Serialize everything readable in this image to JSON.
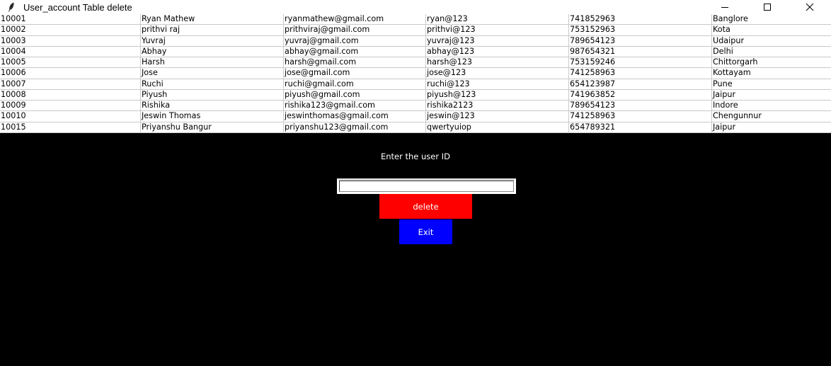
{
  "window": {
    "title": "User_account Table delete",
    "title_icon": "feather-icon",
    "controls": [
      "minimize-icon",
      "maximize-icon",
      "close-icon"
    ]
  },
  "table": {
    "rows": [
      [
        "10001",
        "Ryan Mathew",
        "ryanmathew@gmail.com",
        "ryan@123",
        "741852963",
        "Banglore"
      ],
      [
        "10002",
        "prithvi raj",
        "prithviraj@gmail.com",
        "prithvi@123",
        "753152963",
        "Kota"
      ],
      [
        "10003",
        "Yuvraj",
        "yuvraj@gmail.com",
        "yuvraj@123",
        "789654123",
        "Udaipur"
      ],
      [
        "10004",
        "Abhay",
        "abhay@gmail.com",
        "abhay@123",
        "987654321",
        "Delhi"
      ],
      [
        "10005",
        "Harsh",
        "harsh@gmail.com",
        "harsh@123",
        "753159246",
        "Chittorgarh"
      ],
      [
        "10006",
        "Jose",
        "jose@gmail.com",
        "jose@123",
        "741258963",
        "Kottayam"
      ],
      [
        "10007",
        "Ruchi",
        "ruchi@gmail.com",
        "ruchi@123",
        "654123987",
        "Pune"
      ],
      [
        "10008",
        "Piyush",
        "piyush@gmail.com",
        "piyush@123",
        "741963852",
        "Jaipur"
      ],
      [
        "10009",
        "Rishika",
        "rishika123@gmail.com",
        "rishika2123",
        "789654123",
        "Indore"
      ],
      [
        "10010",
        "Jeswin Thomas",
        "jeswinthomas@gmail.com",
        "jeswin@123",
        "741258963",
        "Chengunnur"
      ],
      [
        "10015",
        "Priyanshu Bangur",
        "priyanshu123@gmail.com",
        "qwertyuiop",
        "654789321",
        "Jaipur"
      ]
    ]
  },
  "form": {
    "prompt": "Enter the user ID",
    "userid_value": "",
    "delete_label": "delete",
    "exit_label": "Exit"
  },
  "colors": {
    "background": "#000000",
    "delete_button": "#ff0000",
    "exit_button": "#0000ff",
    "button_text": "#ffffff"
  }
}
